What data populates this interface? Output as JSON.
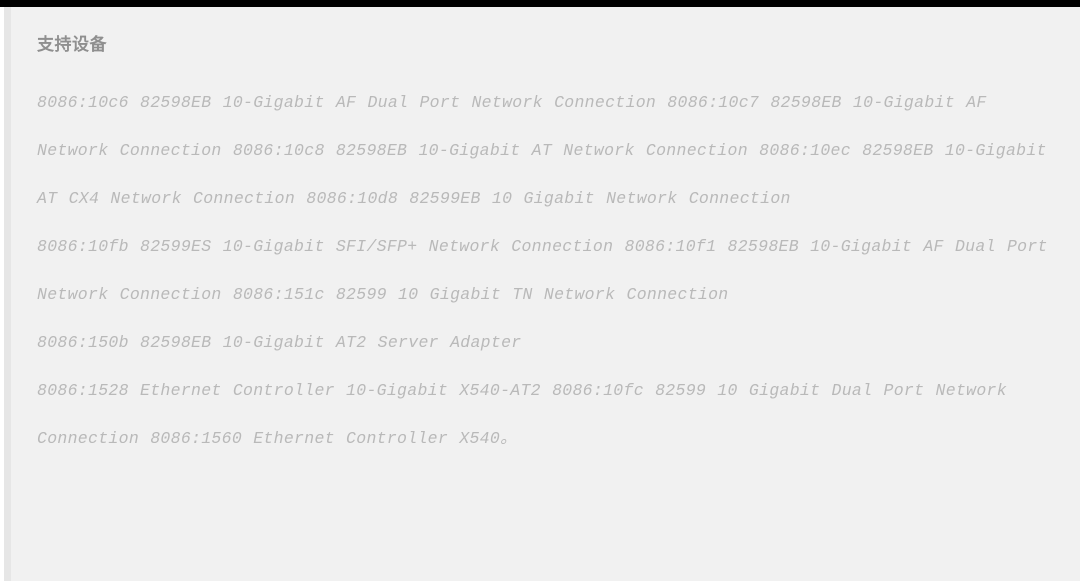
{
  "window": {
    "chrome_bar_color": "#000000",
    "page_background": "#f1f1f1",
    "gutter_color": "#e6e6e6"
  },
  "section": {
    "heading": "支持设备",
    "heading_color": "#8f8f8f",
    "body_color": "#b9b9b9",
    "paragraphs": [
      "8086:10c6 82598EB 10-Gigabit AF Dual Port Network Connection 8086:10c7 82598EB 10-Gigabit AF Network Connection 8086:10c8 82598EB 10-Gigabit AT Network Connection 8086:10ec 82598EB 10-Gigabit AT CX4 Network Connection 8086:10d8 82599EB 10 Gigabit Network Connection",
      "8086:10fb 82599ES 10-Gigabit SFI/SFP+ Network Connection 8086:10f1 82598EB 10-Gigabit AF Dual Port Network Connection 8086:151c 82599 10 Gigabit TN Network Connection",
      "8086:150b 82598EB 10-Gigabit AT2 Server Adapter",
      "8086:1528 Ethernet Controller 10-Gigabit X540-AT2 8086:10fc 82599 10 Gigabit Dual Port Network Connection 8086:1560 Ethernet Controller X540。"
    ]
  }
}
